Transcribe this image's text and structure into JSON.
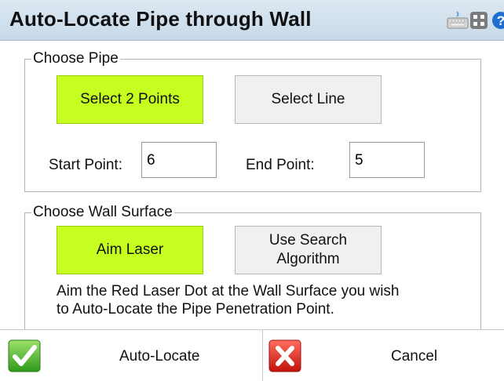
{
  "window": {
    "title": "Auto-Locate Pipe through Wall",
    "icons": [
      "keyboard-icon",
      "grid-icon",
      "help-icon"
    ]
  },
  "choose_pipe": {
    "legend": "Choose Pipe",
    "select_points_label": "Select 2 Points",
    "select_line_label": "Select Line",
    "selected": "select_2_points",
    "start_point_label": "Start Point:",
    "start_point_value": "6",
    "end_point_label": "End Point:",
    "end_point_value": "5"
  },
  "choose_wall": {
    "legend": "Choose Wall Surface",
    "aim_laser_label": "Aim Laser",
    "search_label_line1": "Use Search",
    "search_label_line2": "Algorithm",
    "selected": "aim_laser",
    "description_line1": "Aim the Red Laser Dot at the Wall Surface you wish",
    "description_line2": "to Auto-Locate the Pipe Penetration Point."
  },
  "footer": {
    "auto_locate_label": "Auto-Locate",
    "cancel_label": "Cancel"
  },
  "colors": {
    "active_button": "#c6ff1f",
    "titlebar": "#c7d9e9"
  }
}
